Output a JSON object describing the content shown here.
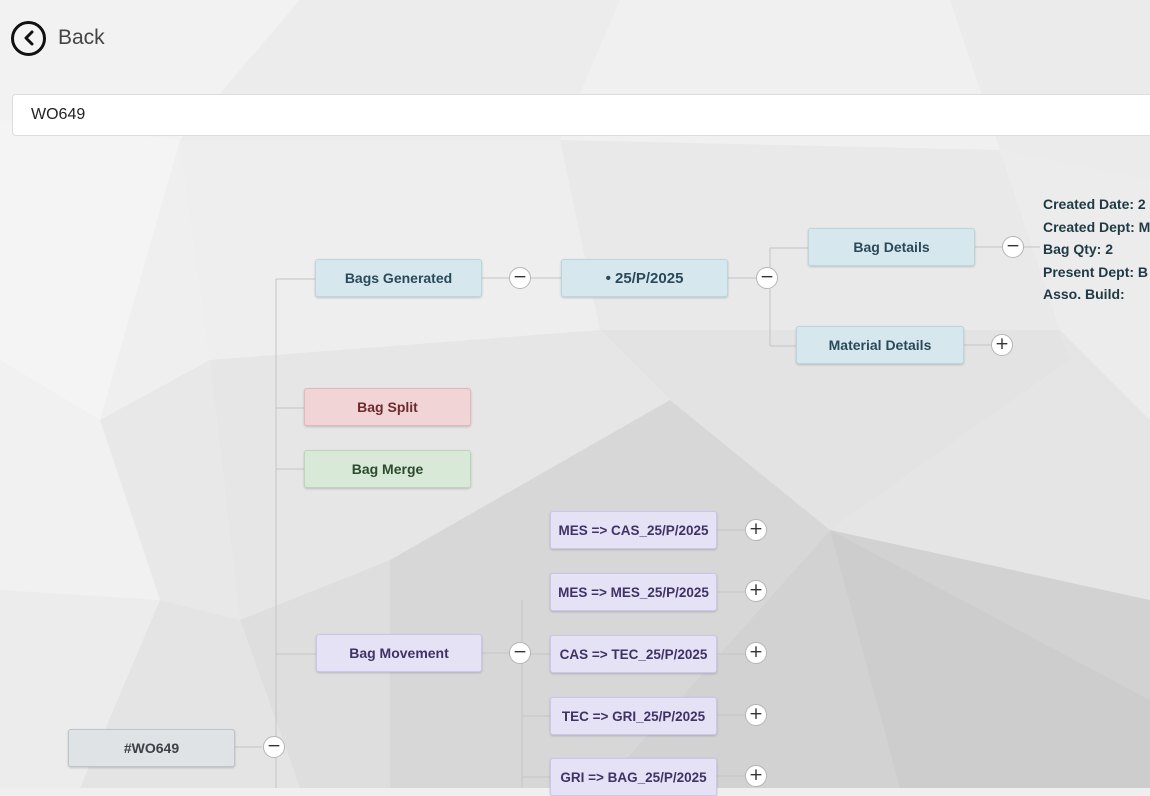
{
  "header": {
    "back_label": "Back"
  },
  "search": {
    "value": "WO649"
  },
  "tree": {
    "root": "#WO649",
    "bags_generated": "Bags Generated",
    "bag_id": "• 25/P/2025",
    "bag_details": "Bag Details",
    "material_details": "Material Details",
    "bag_split": "Bag Split",
    "bag_merge": "Bag Merge",
    "bag_movement": "Bag Movement",
    "movements": [
      "MES => CAS_25/P/2025",
      "MES => MES_25/P/2025",
      "CAS => TEC_25/P/2025",
      "TEC => GRI_25/P/2025",
      "GRI => BAG_25/P/2025"
    ]
  },
  "details": {
    "created_date": "Created Date: 2",
    "created_dept": "Created Dept: M",
    "bag_qty": "Bag Qty: 2",
    "present_dept": "Present Dept: B",
    "asso_build": "Asso. Build:"
  },
  "toggles": {
    "minus": "−",
    "plus": "+"
  },
  "colors": {
    "blue_node": "#d6e8ee",
    "red_node": "#f0d4d6",
    "green_node": "#d8ead7",
    "purple_node": "#e6e2f6",
    "gray_node": "#e0e3e6",
    "detail_text": "#1f3a44"
  }
}
